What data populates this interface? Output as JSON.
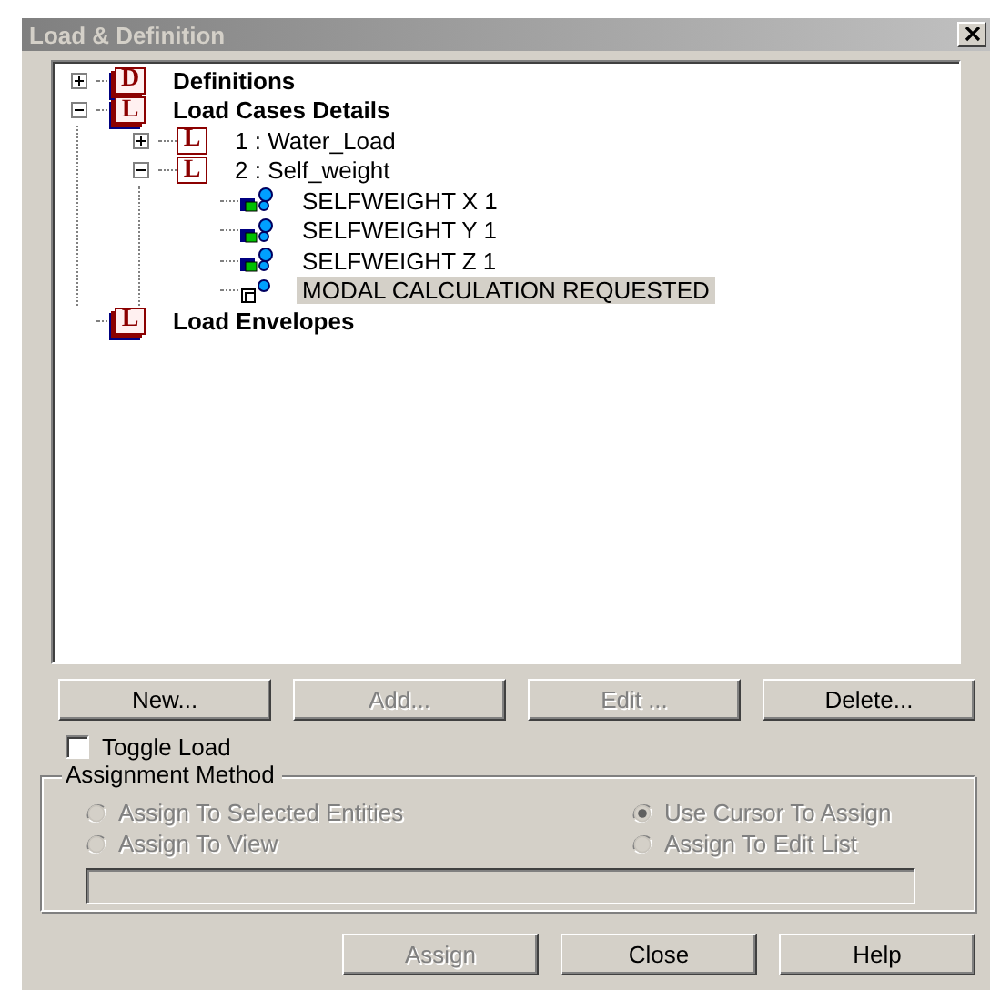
{
  "window": {
    "title": "Load & Definition"
  },
  "tree": [
    {
      "label": "Definitions",
      "badge": "D",
      "kind": "group",
      "expanded": false,
      "selected": false
    },
    {
      "label": "Load Cases Details",
      "badge": "L",
      "kind": "group",
      "expanded": true,
      "selected": false,
      "children": [
        {
          "label": "1 : Water_Load",
          "badge": "L",
          "kind": "case",
          "expanded": false,
          "selected": false
        },
        {
          "label": "2 : Self_weight",
          "badge": "L",
          "kind": "case",
          "expanded": true,
          "selected": false,
          "children": [
            {
              "label": "SELFWEIGHT X 1",
              "kind": "load",
              "selected": false
            },
            {
              "label": "SELFWEIGHT Y 1",
              "kind": "load",
              "selected": false
            },
            {
              "label": "SELFWEIGHT Z 1",
              "kind": "load",
              "selected": false
            },
            {
              "label": "MODAL CALCULATION REQUESTED",
              "kind": "modal",
              "selected": true
            }
          ]
        }
      ]
    },
    {
      "label": "Load Envelopes",
      "badge": "L",
      "kind": "group",
      "selected": false
    }
  ],
  "buttons": [
    {
      "label": "New...",
      "disabled": false
    },
    {
      "label": "Add...",
      "disabled": true
    },
    {
      "label": "Edit ...",
      "disabled": true
    },
    {
      "label": "Delete...",
      "disabled": false
    }
  ],
  "toggle": {
    "label": "Toggle Load",
    "checked": false
  },
  "assignment": {
    "title": "Assignment Method",
    "options": [
      {
        "label": "Assign To Selected Entities",
        "selected": false,
        "disabled": true
      },
      {
        "label": "Use Cursor To Assign",
        "selected": true,
        "disabled": true
      },
      {
        "label": "Assign To View",
        "selected": false,
        "disabled": true
      },
      {
        "label": "Assign To Edit List",
        "selected": false,
        "disabled": true
      }
    ]
  },
  "dialog_buttons": [
    {
      "label": "Assign",
      "disabled": true
    },
    {
      "label": "Close",
      "disabled": false
    },
    {
      "label": "Help",
      "disabled": false
    }
  ]
}
